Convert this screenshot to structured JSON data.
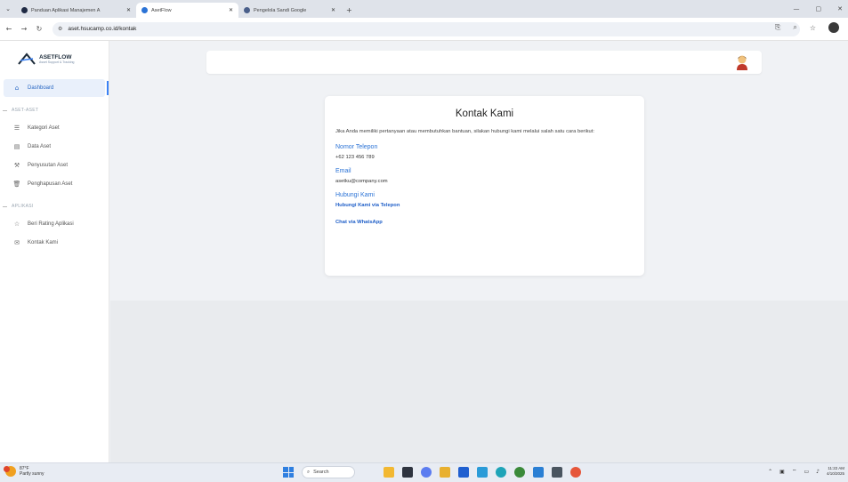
{
  "browser": {
    "tabs": [
      {
        "label": "Panduan Aplikasi Manajemen A",
        "active": false,
        "favicon_color": "#1f2a44"
      },
      {
        "label": "AsetFlow",
        "active": true,
        "favicon_color": "#2b73d6"
      },
      {
        "label": "Pengelola Sandi Google",
        "active": false,
        "favicon_color": "#4a5f8a"
      }
    ],
    "tab_menu_icon": "chevron-down-icon",
    "new_tab_label": "+",
    "url": "aset.hsucamp.co.id/kontak",
    "window_controls": [
      "—",
      "▢",
      "✕"
    ]
  },
  "brand": {
    "name": "ASETFLOW",
    "tagline": "Asset Support & Tracking"
  },
  "sidebar": {
    "items": [
      {
        "type": "item",
        "label": "Dashboard",
        "icon": "home-icon",
        "glyph": "⌂",
        "active": true
      },
      {
        "type": "section",
        "label": "ASET-ASET"
      },
      {
        "type": "item",
        "label": "Kategori Aset",
        "icon": "list-icon",
        "glyph": "☰",
        "active": false
      },
      {
        "type": "item",
        "label": "Data Aset",
        "icon": "calendar-icon",
        "glyph": "▤",
        "active": false
      },
      {
        "type": "item",
        "label": "Penyusutan Aset",
        "icon": "tool-icon",
        "glyph": "⚒",
        "active": false
      },
      {
        "type": "item",
        "label": "Penghapusan Aset",
        "icon": "trash-icon",
        "glyph": "🗑",
        "active": false
      },
      {
        "type": "section",
        "label": "APLIKASI"
      },
      {
        "type": "item",
        "label": "Beri Rating Aplikasi",
        "icon": "star-icon",
        "glyph": "☆",
        "active": false
      },
      {
        "type": "item",
        "label": "Kontak Kami",
        "icon": "mail-icon",
        "glyph": "✉",
        "active": false
      }
    ]
  },
  "contact": {
    "title": "Kontak Kami",
    "intro": "Jika Anda memiliki pertanyaan atau membutuhkan bantuan, silakan hubungi kami melalui salah satu cara berikut:",
    "phone_label": "Nomor Telepon",
    "phone_value": "+62 123 456 789",
    "email_label": "Email",
    "email_value": "asetku@company.com",
    "contact_label": "Hubungi Kami",
    "call_link": "Hubungi Kami via Telepon",
    "whatsapp_link": "Chat via WhatsApp"
  },
  "taskbar": {
    "weather_temp": "87°F",
    "weather_desc": "Partly sunny",
    "search_placeholder": "Search",
    "time": "11:22 AM",
    "date": "4/10/2025",
    "apps": [
      {
        "name": "file-explorer-icon",
        "color": "#f2b832"
      },
      {
        "name": "terminal-icon",
        "color": "#2e3440"
      },
      {
        "name": "copilot-icon",
        "color": "#5b7cf0"
      },
      {
        "name": "folder-icon",
        "color": "#e8b030"
      },
      {
        "name": "store-icon",
        "color": "#1f5fd0"
      },
      {
        "name": "photos-icon",
        "color": "#2a9bd8"
      },
      {
        "name": "edge-icon",
        "color": "#1ea4b8"
      },
      {
        "name": "chrome-icon",
        "color": "#3a8a3a"
      },
      {
        "name": "vscode-icon",
        "color": "#2a7fd4"
      },
      {
        "name": "calculator-icon",
        "color": "#4a5560"
      },
      {
        "name": "paint-icon",
        "color": "#e6563a"
      }
    ]
  }
}
